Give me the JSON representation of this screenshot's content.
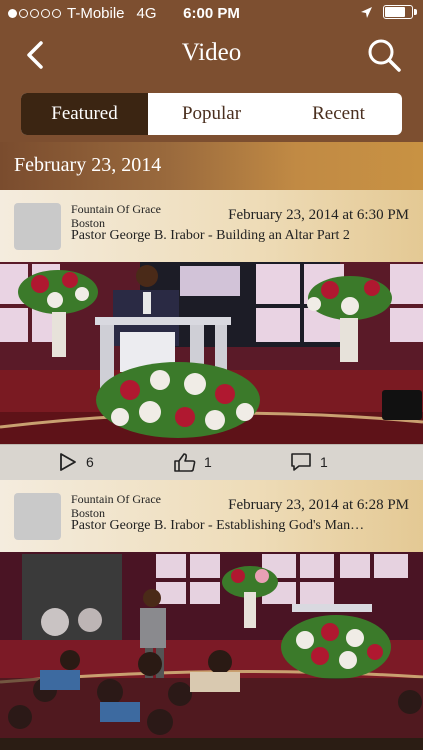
{
  "status": {
    "carrier": "T-Mobile",
    "network": "4G",
    "time": "6:00 PM",
    "signal_filled": 1,
    "signal_total": 5,
    "battery_level": 0.85
  },
  "nav": {
    "title": "Video",
    "back_icon": "chevron-left-icon",
    "search_icon": "search-icon"
  },
  "tabs": [
    {
      "label": "Featured",
      "active": true
    },
    {
      "label": "Popular",
      "active": false
    },
    {
      "label": "Recent",
      "active": false
    }
  ],
  "section_date": "February 23, 2014",
  "videos": [
    {
      "channel_line1": "Fountain Of Grace",
      "channel_line2": "Boston",
      "date": "February 23, 2014 at 6:30 PM",
      "title": "Pastor George B. Irabor - Building an Altar Part 2",
      "plays": "6",
      "likes": "1",
      "comments": "1"
    },
    {
      "channel_line1": "Fountain Of Grace",
      "channel_line2": "Boston",
      "date": "February 23, 2014 at 6:28 PM",
      "title": "Pastor George B. Irabor - Establishing God's Man…",
      "plays": "",
      "likes": "",
      "comments": ""
    }
  ],
  "colors": {
    "bar": "#7d4f30",
    "tab_active": "#3b2512",
    "card_header": "#eedcb8"
  }
}
